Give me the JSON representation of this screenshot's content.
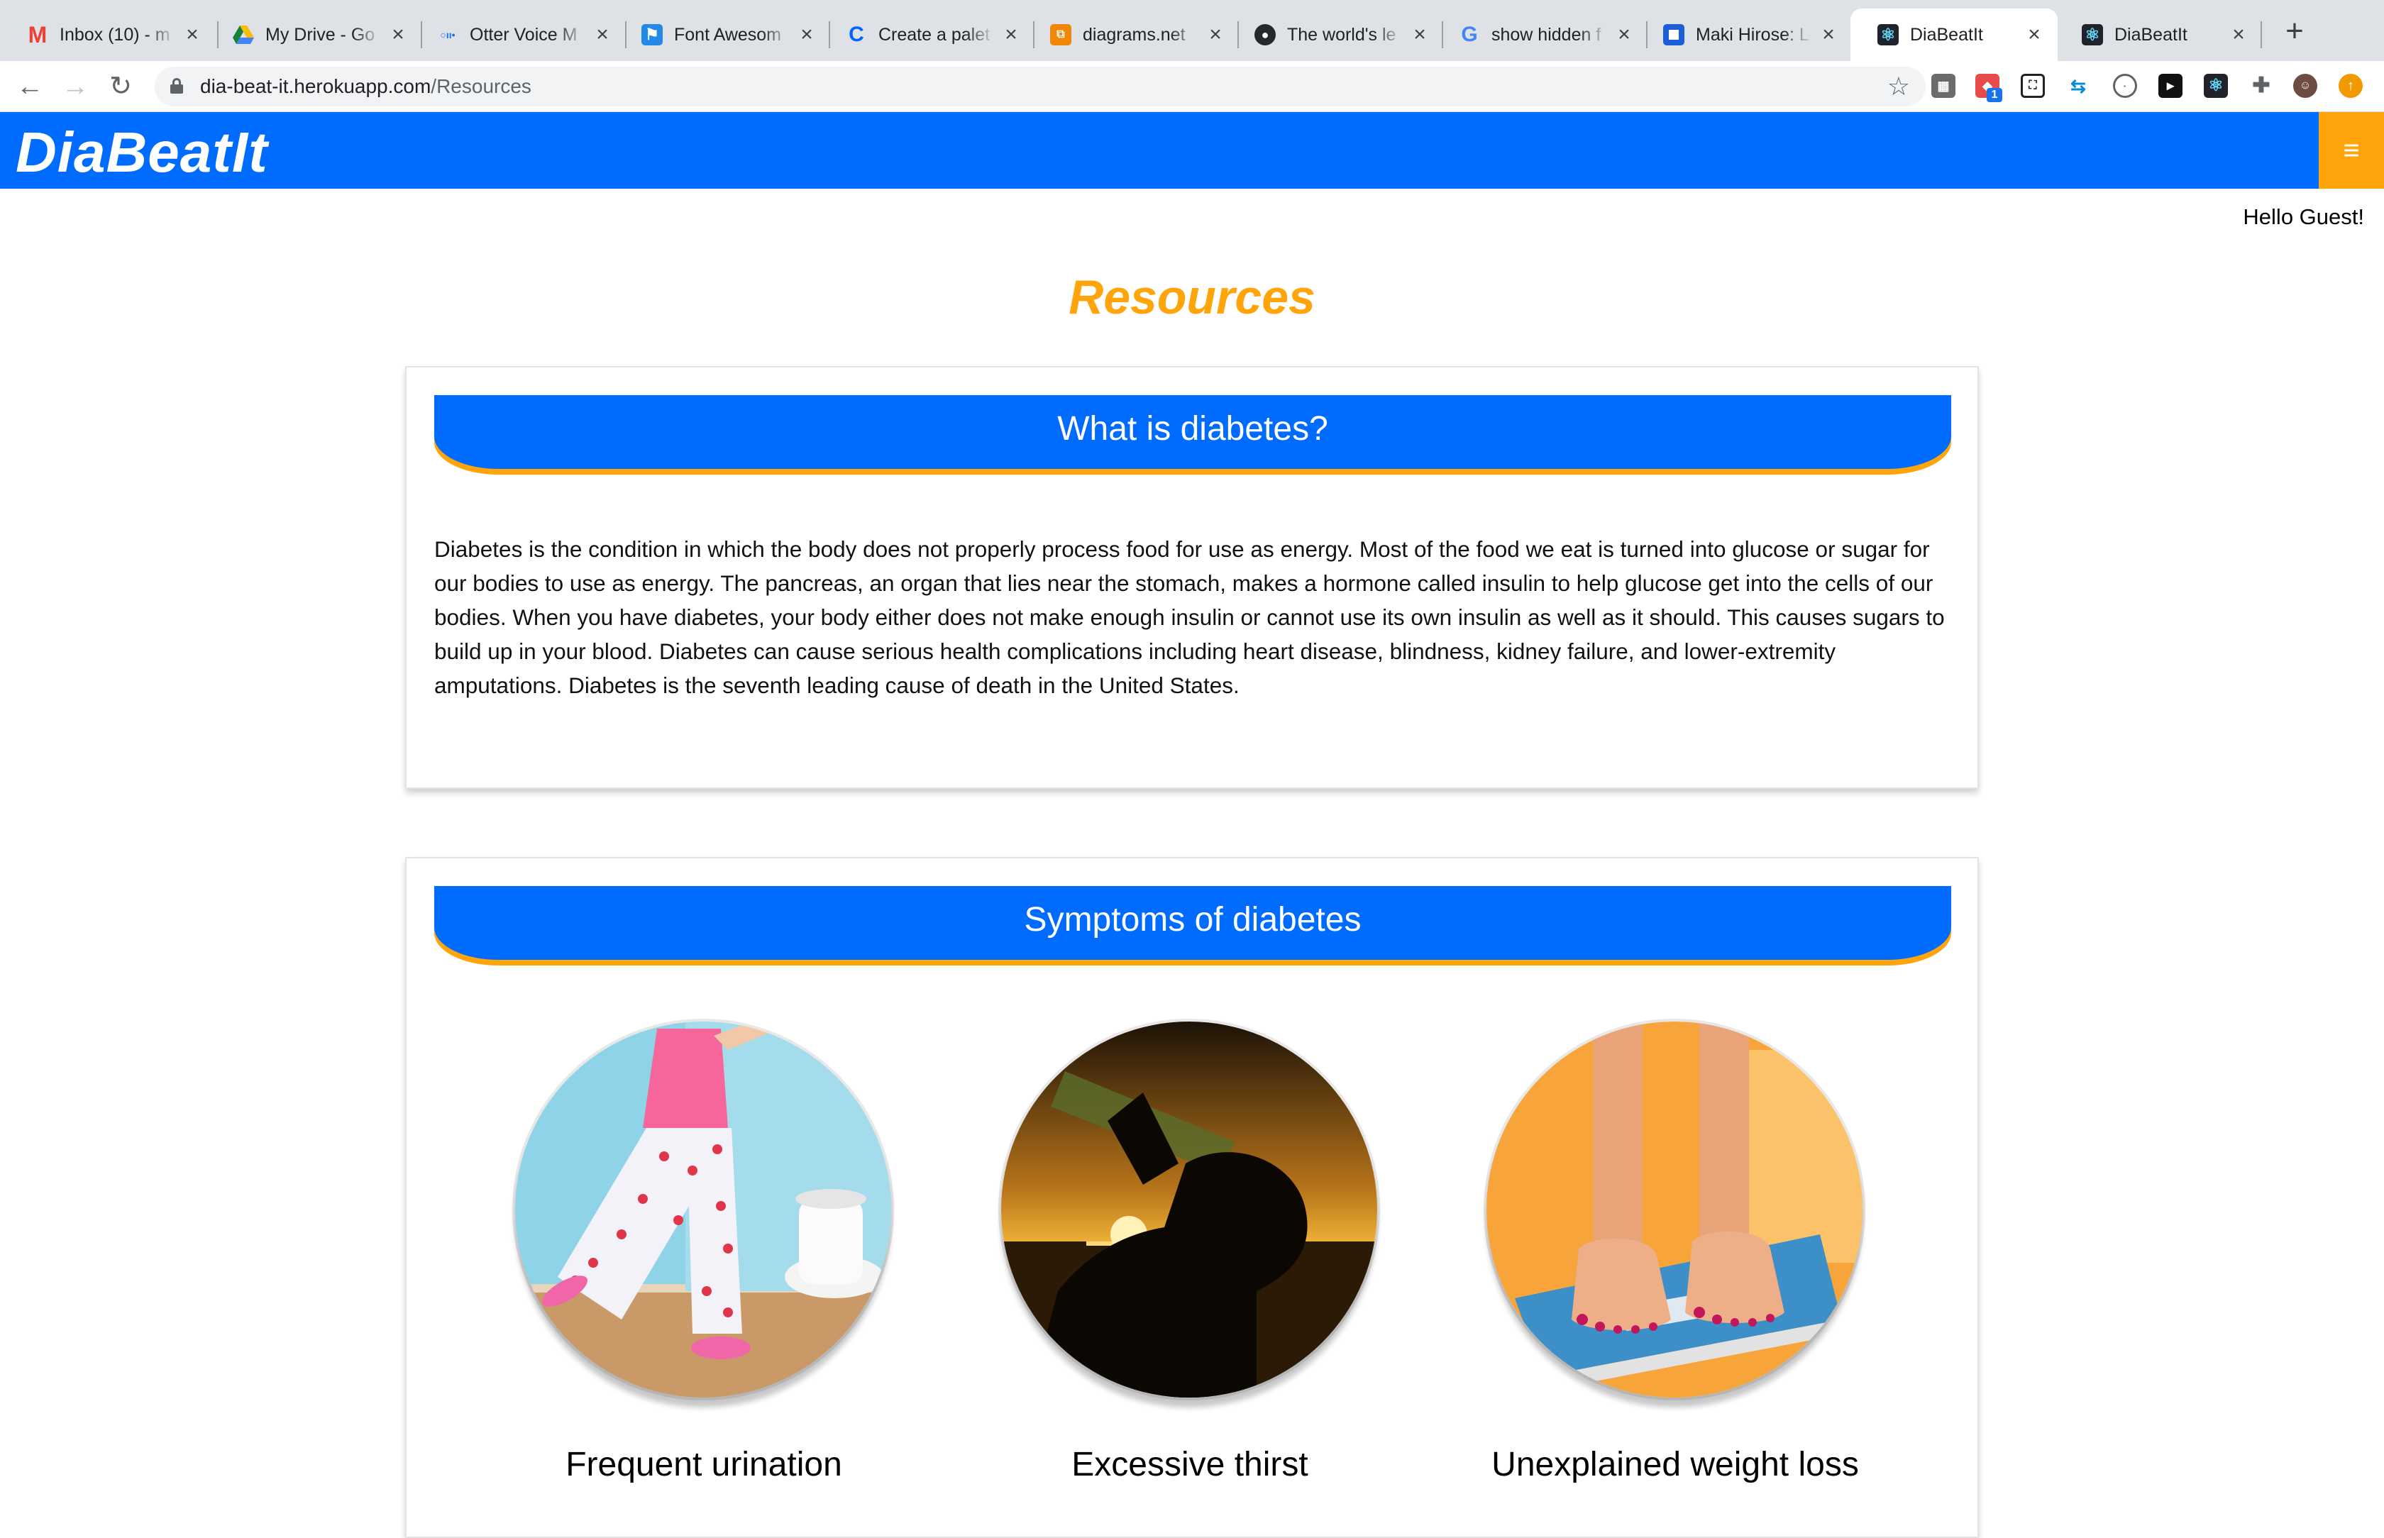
{
  "browser": {
    "tabs": [
      {
        "title": "Inbox (10) - m",
        "icon": "gmail-icon"
      },
      {
        "title": "My Drive - Go",
        "icon": "google-drive-icon"
      },
      {
        "title": "Otter Voice M",
        "icon": "otter-icon"
      },
      {
        "title": "Font Awesom",
        "icon": "font-awesome-flag-icon"
      },
      {
        "title": "Create a palet",
        "icon": "coolors-icon"
      },
      {
        "title": "diagrams.net",
        "icon": "diagrams-icon"
      },
      {
        "title": "The world's le",
        "icon": "github-icon"
      },
      {
        "title": "show hidden f",
        "icon": "google-icon"
      },
      {
        "title": "Maki Hirose: L",
        "icon": "square-icon"
      },
      {
        "title": "DiaBeatIt",
        "icon": "react-icon"
      },
      {
        "title": "DiaBeatIt",
        "icon": "react-icon"
      }
    ],
    "active_tab": 9,
    "url_host": "dia-beat-it.herokuapp.com",
    "url_path": "/Resources",
    "extension_badge": "1"
  },
  "site": {
    "brand": "DiaBeatIt",
    "greeting": "Hello Guest!",
    "page_title": "Resources",
    "menu_icon": "hamburger-icon",
    "colors": {
      "primary": "#006cff",
      "accent": "#ffa40a"
    }
  },
  "sections": {
    "what_is": {
      "heading": "What is diabetes?",
      "body": "Diabetes is the condition in which the body does not properly process food for use as energy. Most of the food we eat is turned into glucose or sugar for our bodies to use as energy. The pancreas, an organ that lies near the stomach, makes a hormone called insulin to help glucose get into the cells of our bodies. When you have diabetes, your body either does not make enough insulin or cannot use its own insulin as well as it should. This causes sugars to build up in your blood. Diabetes can cause serious health complications including heart disease, blindness, kidney failure, and lower-extremity amputations. Diabetes is the seventh leading cause of death in the United States."
    },
    "symptoms": {
      "heading": "Symptoms of diabetes",
      "items": [
        {
          "caption": "Frequent urination"
        },
        {
          "caption": "Excessive thirst"
        },
        {
          "caption": "Unexplained weight loss"
        }
      ]
    }
  }
}
